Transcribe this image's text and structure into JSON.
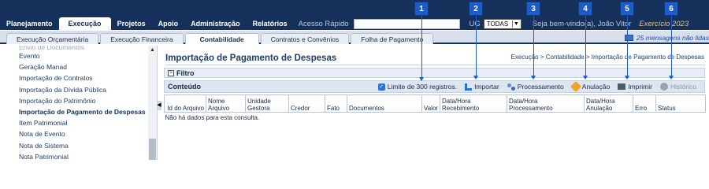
{
  "nav": {
    "items": [
      {
        "label": "Planejamento",
        "active": false
      },
      {
        "label": "Execução",
        "active": true
      },
      {
        "label": "Projetos",
        "active": false
      },
      {
        "label": "Apoio",
        "active": false
      },
      {
        "label": "Administração",
        "active": false
      },
      {
        "label": "Relatórios",
        "active": false
      }
    ],
    "acesso_label": "Acesso Rápido",
    "acesso_value": "",
    "ug_label": "UG",
    "ug_value": "TODAS",
    "welcome": "Seja bem-vindo(a), João Vitor",
    "exercicio": "Exercício 2023"
  },
  "subtabs": [
    {
      "label": "Execução Orçamentária",
      "active": false
    },
    {
      "label": "Execução Financeira",
      "active": false
    },
    {
      "label": "Contabilidade",
      "active": true
    },
    {
      "label": "Contratos e Convênios",
      "active": false
    },
    {
      "label": "Folha de Pagamento",
      "active": false
    }
  ],
  "messages": "25 mensagens não lidas",
  "sidebar": {
    "items": [
      {
        "label": "Envio de Documentos",
        "state": "cut"
      },
      {
        "label": "Evento",
        "state": ""
      },
      {
        "label": "Geração Manad",
        "state": ""
      },
      {
        "label": "Importação de Contratos",
        "state": ""
      },
      {
        "label": "Importação da Dívida Pública",
        "state": ""
      },
      {
        "label": "Importação do Patrimônio",
        "state": ""
      },
      {
        "label": "Importação de Pagamento de Despesas",
        "state": "active"
      },
      {
        "label": "Item Patrimonial",
        "state": ""
      },
      {
        "label": "Nota de Evento",
        "state": ""
      },
      {
        "label": "Nota de Sistema",
        "state": ""
      },
      {
        "label": "Nota Patrimonial",
        "state": ""
      }
    ]
  },
  "main": {
    "title": "Importação de Pagamento de Despesas",
    "breadcrumb": "Execução > Contabilidade > Importação de Pagamento de Despesas",
    "filter_label": "Filtro",
    "content_label": "Conteúdo",
    "toolbar": {
      "limit": "Limite de 300 registros.",
      "importar": "Importar",
      "processamento": "Processamento",
      "anulacao": "Anulação",
      "imprimir": "Imprimir",
      "historico": "Histórico"
    },
    "columns": [
      "Id do Arquivo",
      "Nome Arquivo",
      "Unidade Gestora",
      "Credor",
      "Fato",
      "Documentos",
      "Valor",
      "Data/Hora Recebimento",
      "Data/Hora Processamento",
      "Data/Hora Anulação",
      "Erro",
      "Status"
    ],
    "empty_message": "Não há dados para esta consulta."
  },
  "markers": [
    "1",
    "2",
    "3",
    "4",
    "5",
    "6"
  ],
  "colors": {
    "topbar": "#15305a",
    "marker": "#1f5cc7"
  }
}
